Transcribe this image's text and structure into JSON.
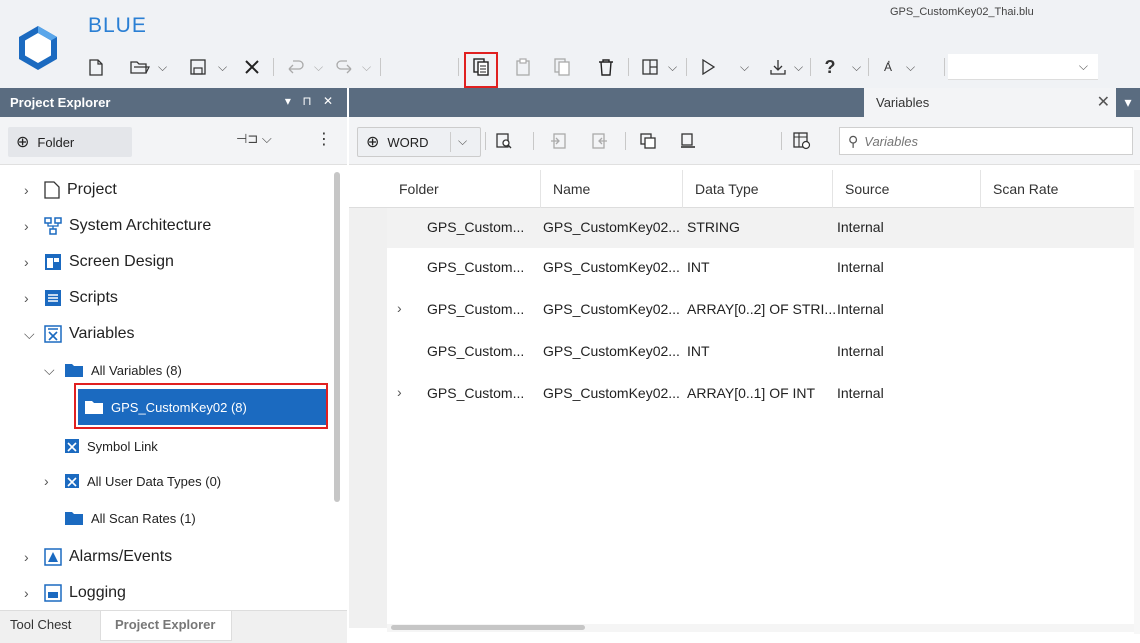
{
  "app": {
    "name": "BLUE",
    "file_name": "GPS_CustomKey02_Thai.blu"
  },
  "toolbar_combo": {
    "value": ""
  },
  "project_explorer": {
    "title": "Project Explorer",
    "controls": "▾ ⊓ ✕",
    "folder_button": "Folder",
    "tree": [
      {
        "label": "Project",
        "icon": "project-icon"
      },
      {
        "label": "System Architecture",
        "icon": "system-architecture-icon"
      },
      {
        "label": "Screen Design",
        "icon": "screen-design-icon"
      },
      {
        "label": "Scripts",
        "icon": "scripts-icon"
      },
      {
        "label": "Variables",
        "icon": "variables-icon"
      },
      {
        "label": "All Variables (8)",
        "icon": "folder-icon"
      },
      {
        "label": "GPS_CustomKey02 (8)",
        "icon": "folder-icon"
      },
      {
        "label": "Symbol Link",
        "icon": "symbol-link-icon"
      },
      {
        "label": "All User Data Types (0)",
        "icon": "user-data-types-icon"
      },
      {
        "label": "All Scan Rates (1)",
        "icon": "folder-icon"
      },
      {
        "label": "Alarms/Events",
        "icon": "alarms-icon"
      },
      {
        "label": "Logging",
        "icon": "logging-icon"
      }
    ],
    "bottom_tabs": [
      "Tool Chest",
      "Project Explorer"
    ]
  },
  "document_tab": {
    "label": "Variables"
  },
  "variables_toolbar": {
    "add_button": "WORD",
    "search_placeholder": "Variables"
  },
  "grid": {
    "columns": [
      "Folder",
      "Name",
      "Data Type",
      "Source",
      "Scan Rate"
    ],
    "rows": [
      {
        "expandable": false,
        "folder": "GPS_Custom...",
        "name": "GPS_CustomKey02...",
        "data_type": "STRING",
        "source": "Internal",
        "scan_rate": ""
      },
      {
        "expandable": false,
        "folder": "GPS_Custom...",
        "name": "GPS_CustomKey02...",
        "data_type": "INT",
        "source": "Internal",
        "scan_rate": ""
      },
      {
        "expandable": true,
        "folder": "GPS_Custom...",
        "name": "GPS_CustomKey02...",
        "data_type": "ARRAY[0..2] OF STRI...",
        "source": "Internal",
        "scan_rate": ""
      },
      {
        "expandable": false,
        "folder": "GPS_Custom...",
        "name": "GPS_CustomKey02...",
        "data_type": "INT",
        "source": "Internal",
        "scan_rate": ""
      },
      {
        "expandable": true,
        "folder": "GPS_Custom...",
        "name": "GPS_CustomKey02...",
        "data_type": "ARRAY[0..1] OF INT",
        "source": "Internal",
        "scan_rate": ""
      }
    ]
  },
  "colors": {
    "accent": "#1b6ac0",
    "panel_header": "#5a6c80",
    "highlight": "#e02020",
    "brand": "#2a7fd4"
  }
}
